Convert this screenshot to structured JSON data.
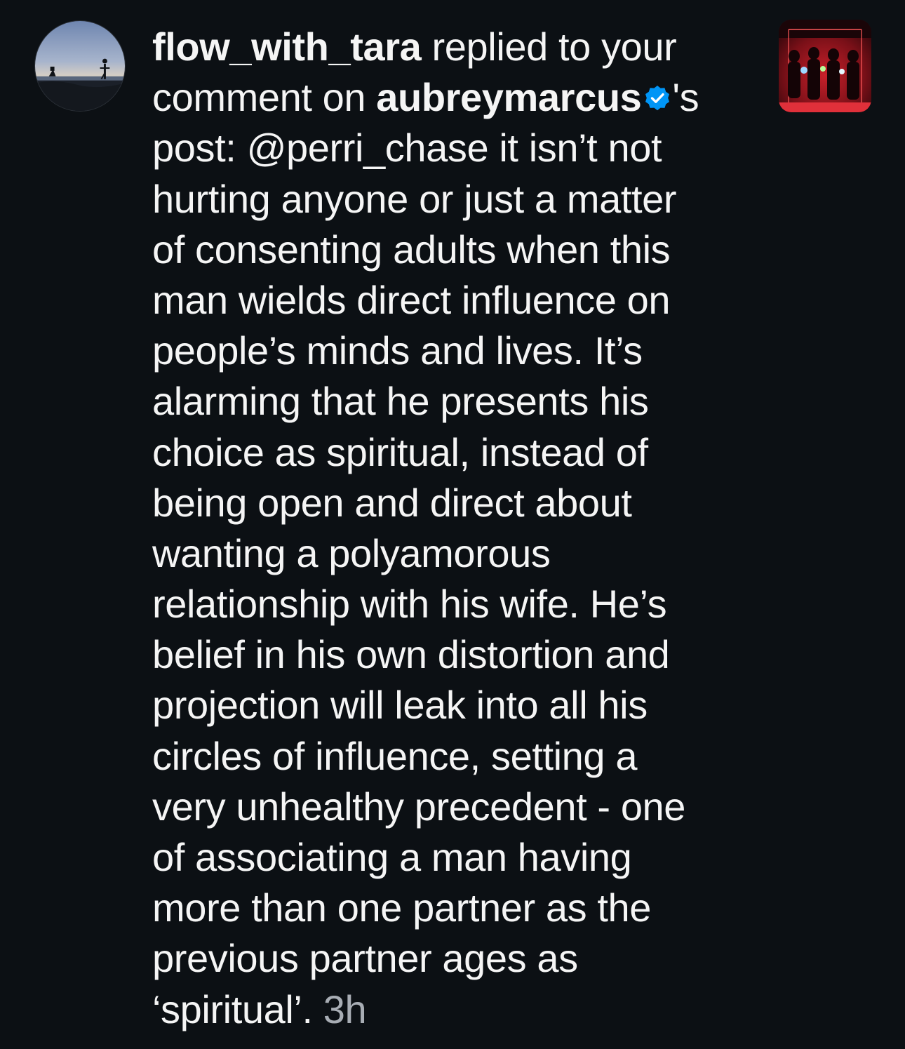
{
  "notification": {
    "replier_username": "flow_with_tara",
    "action_text_1": " replied to your",
    "action_text_2": "comment on ",
    "post_owner_username": "aubreymarcus",
    "post_owner_suffix": "'s",
    "verified_color": "#0095f6",
    "reply_lines": [
      "post: @perri_chase it isn’t not",
      "hurting anyone or just a matter",
      "of consenting adults when this",
      "man wields direct influence on",
      "people’s minds and lives. It’s",
      "alarming that he presents his",
      "choice as spiritual, instead of",
      "being open and direct about",
      "wanting a polyamorous",
      "relationship with his wife. He’s",
      "belief in his own distortion and",
      "projection will leak into all his",
      "circles of influence, setting a",
      "very unhealthy precedent - one",
      "of associating a man having",
      "more than one partner as the",
      "previous partner ages as"
    ],
    "last_line_text": "‘spiritual’. ",
    "timestamp": "3h"
  },
  "colors": {
    "background": "#0c1014",
    "text": "#f5f5f5",
    "timestamp": "#a8adb4",
    "verified": "#0095f6"
  },
  "icons": {
    "avatar": "profile-photo-sunset-beach",
    "post_thumbnail": "post-photo-group-red-light",
    "verified": "verified-badge-icon"
  }
}
